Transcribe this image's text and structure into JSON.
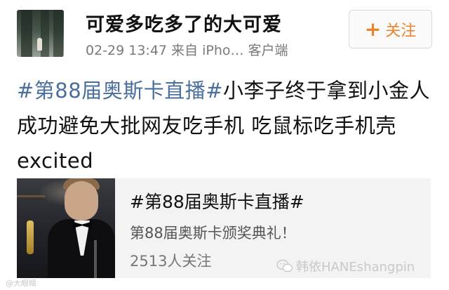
{
  "header": {
    "username": "可爱多吃多了的大可爱",
    "meta": "02-29 13:47  来自 iPho… 客户端",
    "follow_label": "关注"
  },
  "post": {
    "topic": "#第88届奥斯卡直播#",
    "text": "小李子终于拿到小金人 成功避免大批网友吃手机 吃鼠标吃手机壳  excited"
  },
  "card": {
    "title": "#第88届奥斯卡直播#",
    "description": "第88届奥斯卡颁奖典礼！",
    "followers": "2513人关注"
  },
  "watermarks": {
    "right": "韩依HANEshangpin",
    "left": "@大眼睛"
  },
  "colors": {
    "accent": "#e8842c",
    "link": "#4a6f9e",
    "card_bg": "#f3f3f3"
  },
  "icons": {
    "plus": "plus-icon",
    "wechat": "wechat-icon"
  }
}
